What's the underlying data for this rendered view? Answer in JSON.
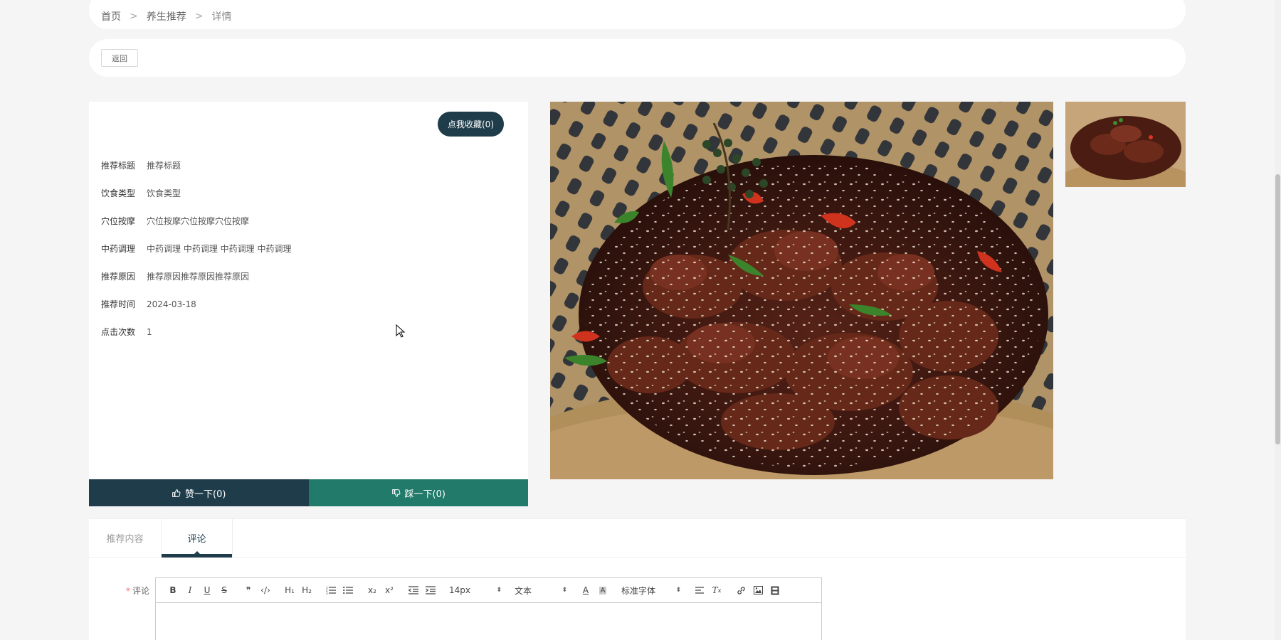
{
  "breadcrumb": {
    "home": "首页",
    "sep": ">",
    "category": "养生推荐",
    "current": "详情"
  },
  "back": {
    "label": "返回"
  },
  "favorite": {
    "label": "点我收藏(0)"
  },
  "details": [
    {
      "label": "推荐标题",
      "value": "推荐标题"
    },
    {
      "label": "饮食类型",
      "value": "饮食类型"
    },
    {
      "label": "穴位按摩",
      "value": "穴位按摩穴位按摩穴位按摩"
    },
    {
      "label": "中药调理",
      "value": "中药调理 中药调理 中药调理 中药调理"
    },
    {
      "label": "推荐原因",
      "value": "推荐原因推荐原因推荐原因"
    },
    {
      "label": "推荐时间",
      "value": "2024-03-18"
    },
    {
      "label": "点击次数",
      "value": "1"
    }
  ],
  "vote": {
    "like": "赞一下(0)",
    "dislike": "踩一下(0)"
  },
  "tabs": [
    {
      "label": "推荐内容"
    },
    {
      "label": "评论"
    }
  ],
  "comment": {
    "required_mark": "*",
    "label": "评论",
    "font_size": "14px",
    "text_style": "文本",
    "font_family": "标准字体"
  },
  "colors": {
    "primary": "#1f3c4a",
    "secondary": "#227a6a",
    "background": "#f5f5f5"
  }
}
